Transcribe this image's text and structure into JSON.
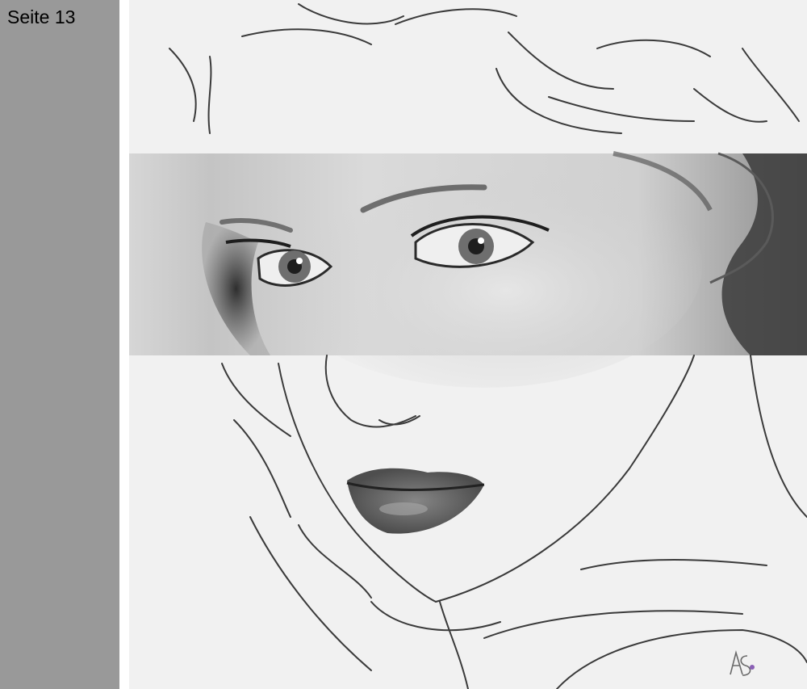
{
  "viewer": {
    "page_label": "Seite 13"
  },
  "colors": {
    "sidebar": "#999999",
    "paper": "#f1f1f1",
    "line": "#3a3a3a",
    "band_light": "#cfcfcf",
    "band_dark": "#5a5a5a",
    "signature_dot": "#8a5fb5"
  }
}
